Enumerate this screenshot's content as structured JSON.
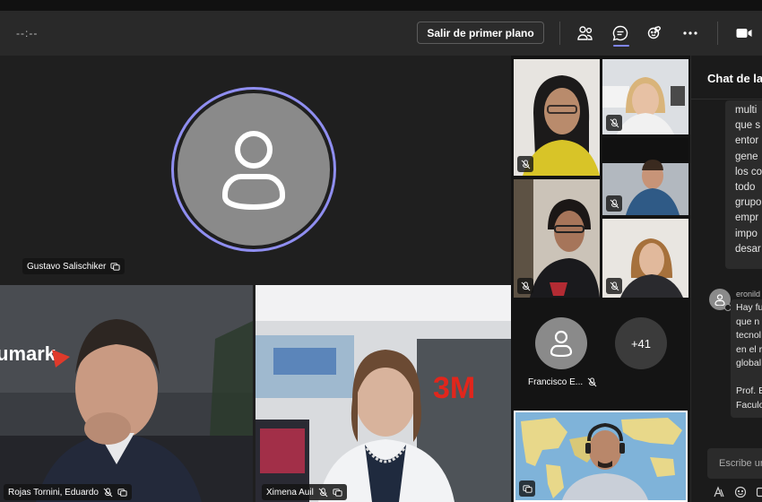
{
  "toolbar": {
    "timer": "--:--",
    "salir_label": "Salir de primer plano",
    "icons": [
      "people-icon",
      "chat-icon",
      "reactions-icon",
      "more-icon",
      "camera-icon"
    ]
  },
  "stage": {
    "main_participant": "Gustavo Salischiker",
    "video1_name": "Rojas Tornini, Eduardo",
    "video1_logo": "umark",
    "video2_name": "Ximena Auil",
    "video2_logo": "3M"
  },
  "grid": {
    "avatar_name": "Francisco E...",
    "overflow_count": "+41"
  },
  "chat": {
    "title": "Chat de la",
    "message1_lines": [
      "multi",
      "que s",
      "entor",
      "gene",
      "los co",
      "todo",
      "grupo",
      "empr",
      "impo",
      "desar"
    ],
    "message2_sender": "eronild",
    "message2_lines": [
      "Hay fu",
      "que n",
      "tecnol",
      "en el r",
      "global",
      "",
      "Prof. E",
      "Faculo"
    ],
    "input_placeholder": "Escribe ur"
  },
  "colors": {
    "accent": "#7f85f5",
    "avatar_ring": "#8f8ef0",
    "background": "#1f1f1f"
  }
}
